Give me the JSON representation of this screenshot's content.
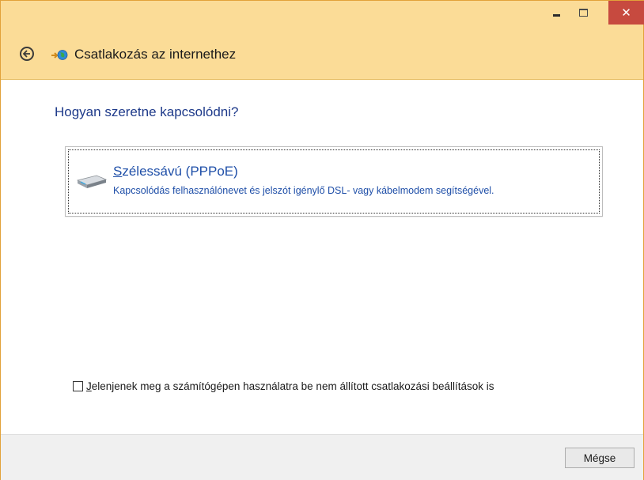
{
  "window": {
    "title": "Csatlakozás az internethez",
    "controls": {
      "close_symbol": "✕"
    }
  },
  "content": {
    "question": "Hogyan szeretne kapcsolódni?",
    "option": {
      "title_access_key": "S",
      "title_rest": "zélessávú (PPPoE)",
      "description": "Kapcsolódás felhasználónevet és jelszót igénylő DSL- vagy kábelmodem segítségével.",
      "icon": "modem-icon"
    },
    "show_unconfigured": {
      "checked": false,
      "label_access_key": "J",
      "label_rest": "elenjenek meg a számítógépen használatra be nem állított csatlakozási beállítások is"
    }
  },
  "footer": {
    "cancel_label": "Mégse"
  },
  "colors": {
    "titlebar": "#fbdc97",
    "close_button": "#c74a3f",
    "link_text": "#1f4fa8",
    "question_text": "#1e3a8a",
    "footer_bg": "#f0f0f0"
  }
}
